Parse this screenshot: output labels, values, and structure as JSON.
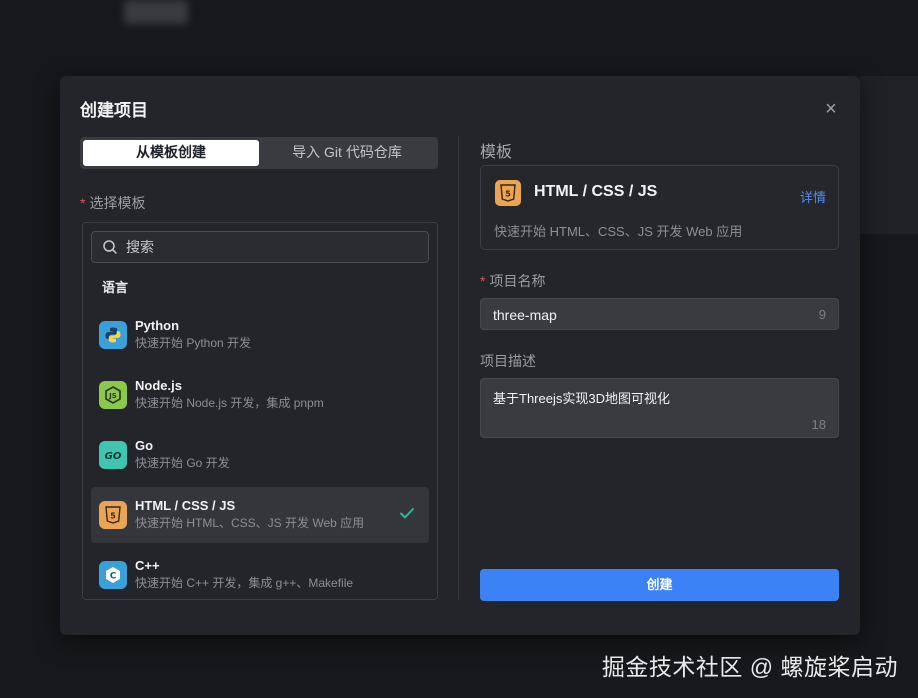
{
  "modal": {
    "title": "创建项目",
    "close_icon": "×"
  },
  "tabs": [
    {
      "label": "从模板创建",
      "active": true
    },
    {
      "label": "导入 Git 代码仓库",
      "active": false
    }
  ],
  "template_picker": {
    "label": "选择模板",
    "search_placeholder": "搜索",
    "group_label": "语言",
    "items": [
      {
        "name": "Python",
        "desc": "快速开始 Python 开发",
        "icon": "python-icon",
        "color": "#3b9fd8"
      },
      {
        "name": "Node.js",
        "desc": "快速开始 Node.js 开发，集成 pnpm",
        "icon": "nodejs-icon",
        "color": "#8cc84b"
      },
      {
        "name": "Go",
        "desc": "快速开始 Go 开发",
        "icon": "go-icon",
        "color": "#3fc5b0"
      },
      {
        "name": "HTML / CSS / JS",
        "desc": "快速开始 HTML、CSS、JS 开发 Web 应用",
        "icon": "html5-icon",
        "color": "#e9a553",
        "selected": true
      },
      {
        "name": "C++",
        "desc": "快速开始 C++ 开发，集成 g++、Makefile",
        "icon": "cpp-icon",
        "color": "#3b9fd8"
      }
    ]
  },
  "template_card": {
    "section_title": "模板",
    "title": "HTML / CSS / JS",
    "detail_link": "详情",
    "desc": "快速开始 HTML、CSS、JS 开发 Web 应用"
  },
  "project_name": {
    "label": "项目名称",
    "value": "three-map",
    "count": "9"
  },
  "project_desc": {
    "label": "项目描述",
    "value": "基于Threejs实现3D地图可视化",
    "count": "18"
  },
  "submit_label": "创建",
  "watermark": "掘金技术社区 @ 螺旋桨启动",
  "colors": {
    "accent": "#3b82f6",
    "required": "#e5524a",
    "check": "#2fb89a"
  }
}
